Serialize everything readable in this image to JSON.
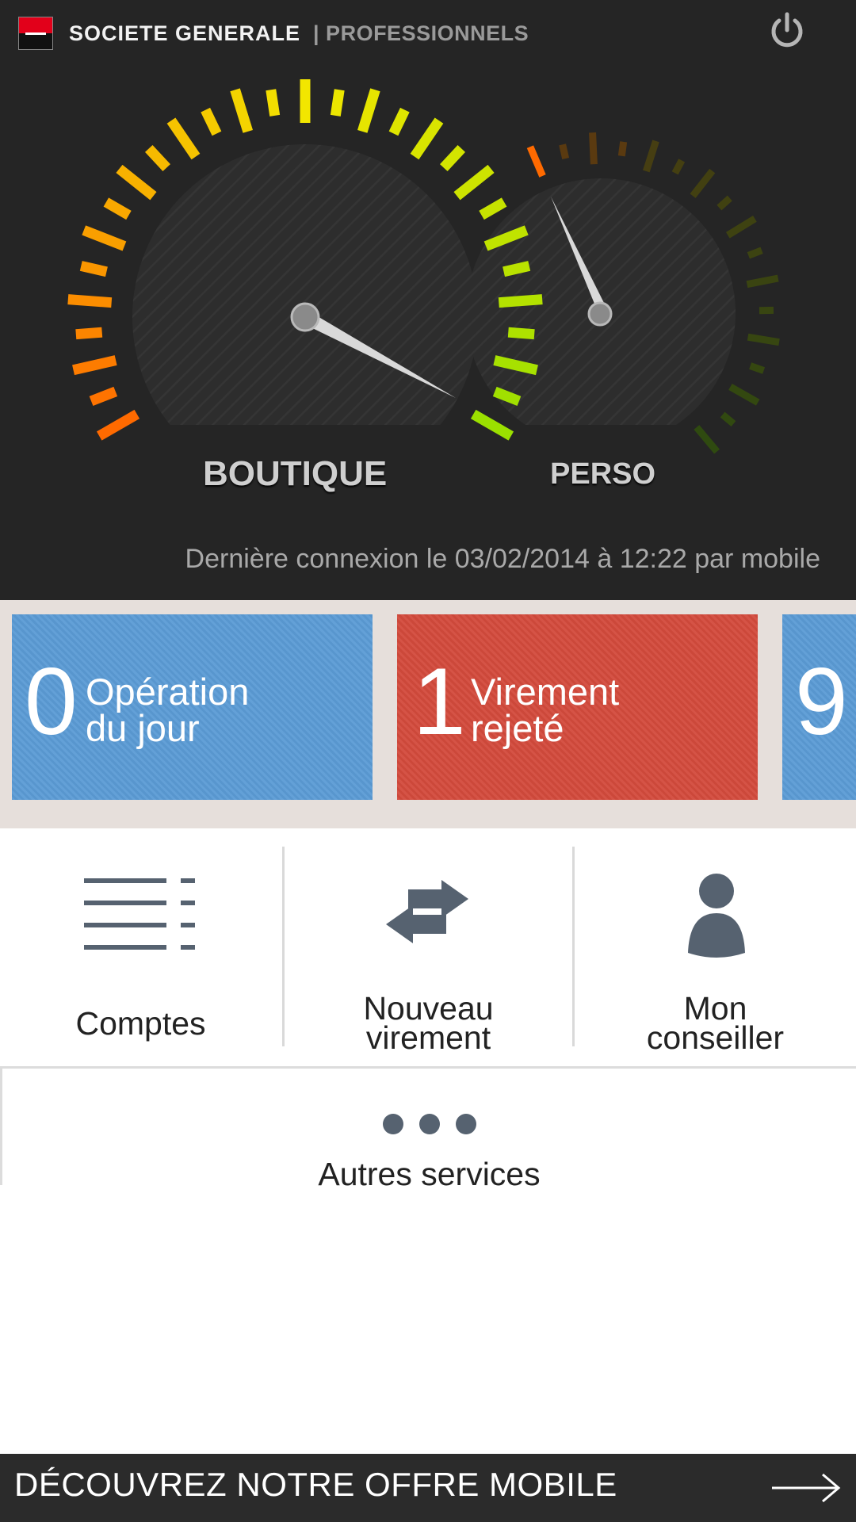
{
  "header": {
    "brand_name": "SOCIETE GENERALE",
    "brand_suffix": "| PROFESSIONNELS",
    "power_icon": "power-icon",
    "brand_red": "#e2001a"
  },
  "gauges": {
    "left_label": "BOUTIQUE",
    "right_label": "PERSO"
  },
  "last_connection": "Dernière connexion le 03/02/2014 à 12:22 par mobile",
  "tiles": [
    {
      "count": "0",
      "line1": "Opération",
      "line2": "du jour",
      "color": "#5b9bd5"
    },
    {
      "count": "1",
      "line1": "Virement",
      "line2": "rejeté",
      "color": "#d34a3c"
    },
    {
      "count": "9",
      "line1": "",
      "line2": "",
      "color": "#5b9bd5"
    }
  ],
  "shortcuts": [
    {
      "line1": "Comptes",
      "line2": "",
      "icon": "list-icon"
    },
    {
      "line1": "Nouveau",
      "line2": "virement",
      "icon": "transfer-arrows-icon"
    },
    {
      "line1": "Mon",
      "line2": "conseiller",
      "icon": "person-icon"
    }
  ],
  "more": {
    "label": "Autres services",
    "icon": "more-dots-icon"
  },
  "banner": {
    "text": "DÉCOUVREZ NOTRE OFFRE MOBILE",
    "icon": "arrow-right-icon"
  },
  "colors": {
    "icon_slate": "#566270",
    "header_bg": "#252525"
  }
}
